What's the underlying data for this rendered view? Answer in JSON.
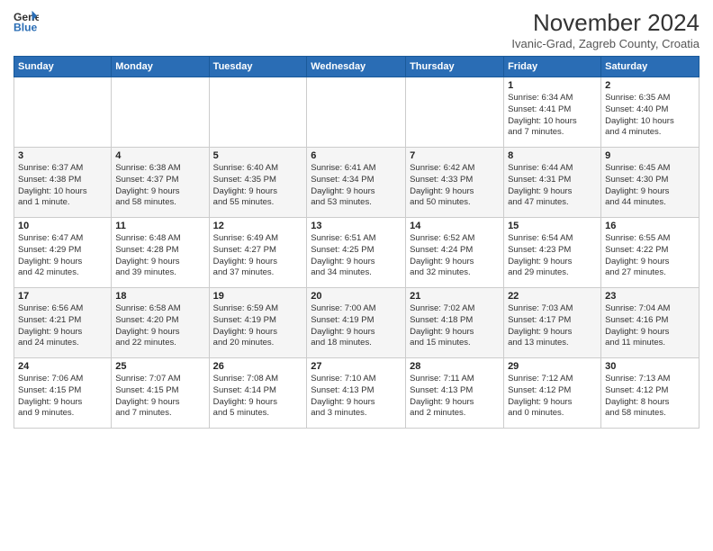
{
  "header": {
    "logo_line1": "General",
    "logo_line2": "Blue",
    "month": "November 2024",
    "location": "Ivanic-Grad, Zagreb County, Croatia"
  },
  "weekdays": [
    "Sunday",
    "Monday",
    "Tuesday",
    "Wednesday",
    "Thursday",
    "Friday",
    "Saturday"
  ],
  "weeks": [
    [
      {
        "day": "",
        "info": ""
      },
      {
        "day": "",
        "info": ""
      },
      {
        "day": "",
        "info": ""
      },
      {
        "day": "",
        "info": ""
      },
      {
        "day": "",
        "info": ""
      },
      {
        "day": "1",
        "info": "Sunrise: 6:34 AM\nSunset: 4:41 PM\nDaylight: 10 hours\nand 7 minutes."
      },
      {
        "day": "2",
        "info": "Sunrise: 6:35 AM\nSunset: 4:40 PM\nDaylight: 10 hours\nand 4 minutes."
      }
    ],
    [
      {
        "day": "3",
        "info": "Sunrise: 6:37 AM\nSunset: 4:38 PM\nDaylight: 10 hours\nand 1 minute."
      },
      {
        "day": "4",
        "info": "Sunrise: 6:38 AM\nSunset: 4:37 PM\nDaylight: 9 hours\nand 58 minutes."
      },
      {
        "day": "5",
        "info": "Sunrise: 6:40 AM\nSunset: 4:35 PM\nDaylight: 9 hours\nand 55 minutes."
      },
      {
        "day": "6",
        "info": "Sunrise: 6:41 AM\nSunset: 4:34 PM\nDaylight: 9 hours\nand 53 minutes."
      },
      {
        "day": "7",
        "info": "Sunrise: 6:42 AM\nSunset: 4:33 PM\nDaylight: 9 hours\nand 50 minutes."
      },
      {
        "day": "8",
        "info": "Sunrise: 6:44 AM\nSunset: 4:31 PM\nDaylight: 9 hours\nand 47 minutes."
      },
      {
        "day": "9",
        "info": "Sunrise: 6:45 AM\nSunset: 4:30 PM\nDaylight: 9 hours\nand 44 minutes."
      }
    ],
    [
      {
        "day": "10",
        "info": "Sunrise: 6:47 AM\nSunset: 4:29 PM\nDaylight: 9 hours\nand 42 minutes."
      },
      {
        "day": "11",
        "info": "Sunrise: 6:48 AM\nSunset: 4:28 PM\nDaylight: 9 hours\nand 39 minutes."
      },
      {
        "day": "12",
        "info": "Sunrise: 6:49 AM\nSunset: 4:27 PM\nDaylight: 9 hours\nand 37 minutes."
      },
      {
        "day": "13",
        "info": "Sunrise: 6:51 AM\nSunset: 4:25 PM\nDaylight: 9 hours\nand 34 minutes."
      },
      {
        "day": "14",
        "info": "Sunrise: 6:52 AM\nSunset: 4:24 PM\nDaylight: 9 hours\nand 32 minutes."
      },
      {
        "day": "15",
        "info": "Sunrise: 6:54 AM\nSunset: 4:23 PM\nDaylight: 9 hours\nand 29 minutes."
      },
      {
        "day": "16",
        "info": "Sunrise: 6:55 AM\nSunset: 4:22 PM\nDaylight: 9 hours\nand 27 minutes."
      }
    ],
    [
      {
        "day": "17",
        "info": "Sunrise: 6:56 AM\nSunset: 4:21 PM\nDaylight: 9 hours\nand 24 minutes."
      },
      {
        "day": "18",
        "info": "Sunrise: 6:58 AM\nSunset: 4:20 PM\nDaylight: 9 hours\nand 22 minutes."
      },
      {
        "day": "19",
        "info": "Sunrise: 6:59 AM\nSunset: 4:19 PM\nDaylight: 9 hours\nand 20 minutes."
      },
      {
        "day": "20",
        "info": "Sunrise: 7:00 AM\nSunset: 4:19 PM\nDaylight: 9 hours\nand 18 minutes."
      },
      {
        "day": "21",
        "info": "Sunrise: 7:02 AM\nSunset: 4:18 PM\nDaylight: 9 hours\nand 15 minutes."
      },
      {
        "day": "22",
        "info": "Sunrise: 7:03 AM\nSunset: 4:17 PM\nDaylight: 9 hours\nand 13 minutes."
      },
      {
        "day": "23",
        "info": "Sunrise: 7:04 AM\nSunset: 4:16 PM\nDaylight: 9 hours\nand 11 minutes."
      }
    ],
    [
      {
        "day": "24",
        "info": "Sunrise: 7:06 AM\nSunset: 4:15 PM\nDaylight: 9 hours\nand 9 minutes."
      },
      {
        "day": "25",
        "info": "Sunrise: 7:07 AM\nSunset: 4:15 PM\nDaylight: 9 hours\nand 7 minutes."
      },
      {
        "day": "26",
        "info": "Sunrise: 7:08 AM\nSunset: 4:14 PM\nDaylight: 9 hours\nand 5 minutes."
      },
      {
        "day": "27",
        "info": "Sunrise: 7:10 AM\nSunset: 4:13 PM\nDaylight: 9 hours\nand 3 minutes."
      },
      {
        "day": "28",
        "info": "Sunrise: 7:11 AM\nSunset: 4:13 PM\nDaylight: 9 hours\nand 2 minutes."
      },
      {
        "day": "29",
        "info": "Sunrise: 7:12 AM\nSunset: 4:12 PM\nDaylight: 9 hours\nand 0 minutes."
      },
      {
        "day": "30",
        "info": "Sunrise: 7:13 AM\nSunset: 4:12 PM\nDaylight: 8 hours\nand 58 minutes."
      }
    ]
  ]
}
